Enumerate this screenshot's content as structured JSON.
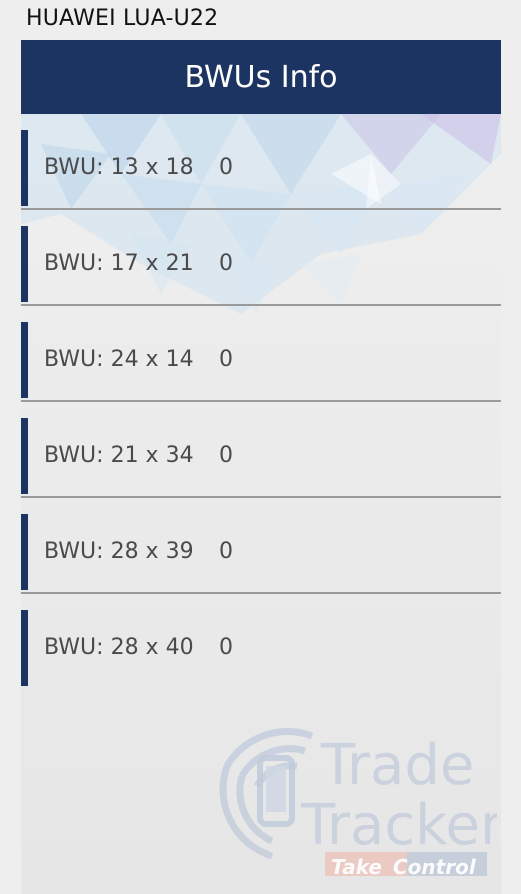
{
  "device": {
    "title": "HUAWEI LUA-U22"
  },
  "appbar": {
    "title": "BWUs Info"
  },
  "bwus": [
    {
      "label": "BWU: 13 x 18",
      "value": "0"
    },
    {
      "label": "BWU: 17 x 21",
      "value": "0"
    },
    {
      "label": "BWU: 24 x 14",
      "value": "0"
    },
    {
      "label": "BWU: 21 x 34",
      "value": "0"
    },
    {
      "label": "BWU: 28 x 39",
      "value": "0"
    },
    {
      "label": "BWU: 28 x 40",
      "value": "0"
    }
  ],
  "watermark": {
    "brand_line1": "Trade",
    "brand_line2": "Tracker",
    "tagline_part1": "Take",
    "tagline_part2": "Control",
    "icon": "phone-signal-logo"
  },
  "colors": {
    "primary": "#1c3461",
    "text": "#4a4a4a",
    "divider": "#9a9a9a"
  }
}
